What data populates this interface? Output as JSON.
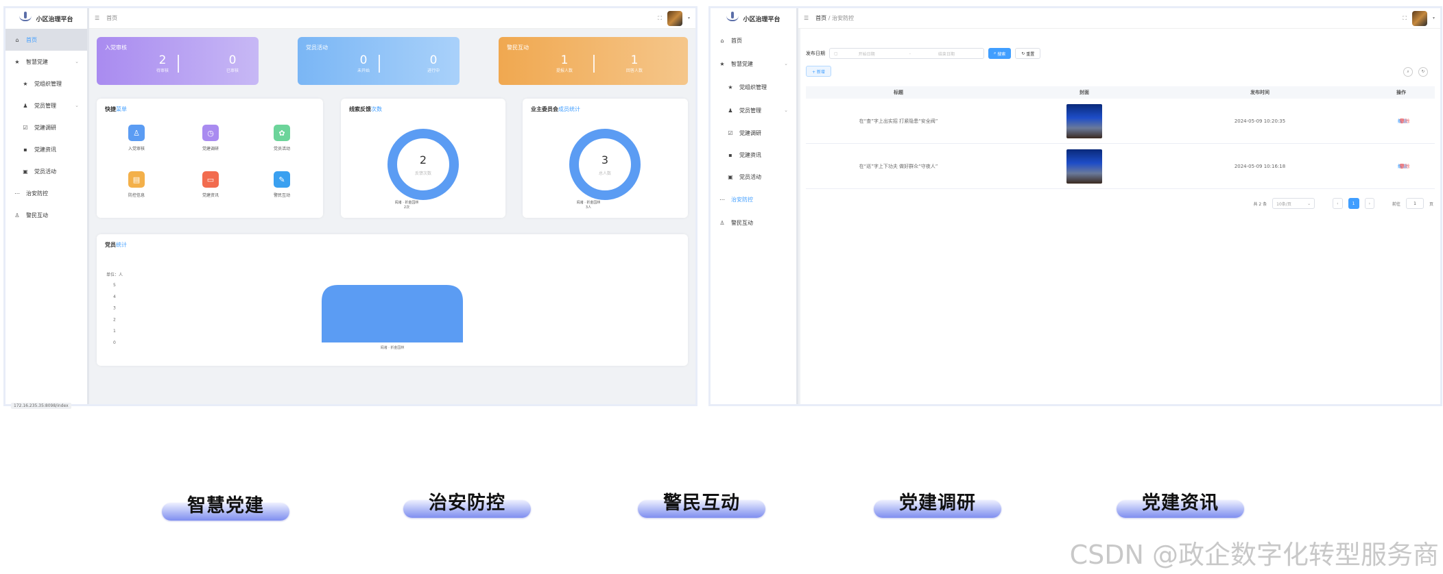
{
  "app_title": "小区治理平台",
  "left": {
    "breadcrumb": "首页",
    "menu": [
      {
        "label": "首页",
        "icon": "home-icon"
      },
      {
        "label": "智慧党建",
        "icon": "star-icon"
      },
      {
        "label": "党组织管理",
        "icon": "star-icon"
      },
      {
        "label": "党员管理",
        "icon": "users-icon"
      },
      {
        "label": "党建调研",
        "icon": "check-icon"
      },
      {
        "label": "党建资讯",
        "icon": "chat-icon"
      },
      {
        "label": "党员活动",
        "icon": "calendar-icon"
      },
      {
        "label": "治安防控",
        "icon": "line-icon"
      },
      {
        "label": "警民互动",
        "icon": "person-icon"
      }
    ],
    "stats": [
      {
        "title": "入党审核",
        "a_value": "2",
        "a_label": "待审核",
        "b_value": "0",
        "b_label": "已审核"
      },
      {
        "title": "党员活动",
        "a_value": "0",
        "a_label": "未开始",
        "b_value": "0",
        "b_label": "进行中"
      },
      {
        "title": "警民互动",
        "a_value": "1",
        "a_label": "提报人数",
        "b_value": "1",
        "b_label": "回答人数"
      }
    ],
    "quick": {
      "title_plain": "快捷",
      "title_blue": "菜单",
      "items": [
        {
          "label": "入党审核",
          "icon": "user-add-icon",
          "color": "#5b9cf3"
        },
        {
          "label": "党建调研",
          "icon": "clock-icon",
          "color": "#a98bf0"
        },
        {
          "label": "党员活动",
          "icon": "badge-icon",
          "color": "#6cd49a"
        },
        {
          "label": "防控信息",
          "icon": "folder-icon",
          "color": "#f3b04a"
        },
        {
          "label": "党建资讯",
          "icon": "card-icon",
          "color": "#f26c4f"
        },
        {
          "label": "警民互动",
          "icon": "edit-icon",
          "color": "#3aa0f0"
        }
      ]
    },
    "feedback": {
      "title_plain": "线索反馈",
      "title_blue": "次数",
      "value": "2",
      "sub": "反馈次数",
      "legend": "阎渚 · 折金园林",
      "legend_val": "2次"
    },
    "committee": {
      "title_plain": "业主委员会",
      "title_blue": "成员统计",
      "value": "3",
      "sub": "总人数",
      "legend": "阎渚 · 折金园林",
      "legend_val": "3人"
    },
    "party_stats": {
      "title_plain": "党员",
      "title_blue": "统计",
      "unit": "单位：人",
      "xlabel": "阎渚 · 折金园林"
    },
    "status_url": "172.16.235.35:8098/index"
  },
  "right": {
    "breadcrumb_home": "首页",
    "breadcrumb_sep": "/",
    "breadcrumb_page": "治安防控",
    "filter": {
      "label": "发布日期",
      "start": "开始日期",
      "dash": "-",
      "end": "结束日期",
      "search": "搜索",
      "reset": "重置"
    },
    "add_label": "+ 新增",
    "columns": [
      "标题",
      "封面",
      "发布时间",
      "操作"
    ],
    "rows": [
      {
        "title": "在“查”字上出实招 打紧隐患“安全阀”",
        "time": "2024-05-09 10:20:35",
        "edit": "编辑",
        "del": "删除"
      },
      {
        "title": "在“巡”字上下功夫 做好群众“守夜人”",
        "time": "2024-05-09 10:16:18",
        "edit": "编辑",
        "del": "删除"
      }
    ],
    "pager": {
      "total": "共 2 条",
      "size": "10条/页",
      "page": "1",
      "goto": "前往",
      "goto_val": "1",
      "page_unit": "页"
    }
  },
  "chart_data": {
    "type": "bar",
    "categories": [
      "阎渚 · 折金园林"
    ],
    "values": [
      5
    ],
    "ylabel": "单位：人",
    "ylim": [
      0,
      5
    ],
    "yticks": [
      0,
      1,
      2,
      3,
      4,
      5
    ],
    "color": "#5b9cf3"
  },
  "features": [
    "智慧党建",
    "治安防控",
    "警民互动",
    "党建调研",
    "党建资讯"
  ],
  "watermark": "CSDN @政企数字化转型服务商",
  "colors": {
    "accent": "#409eff",
    "purple": "#a98bf0",
    "blue": "#7ab6f5",
    "orange": "#f0a850",
    "danger": "#f56c6c"
  }
}
